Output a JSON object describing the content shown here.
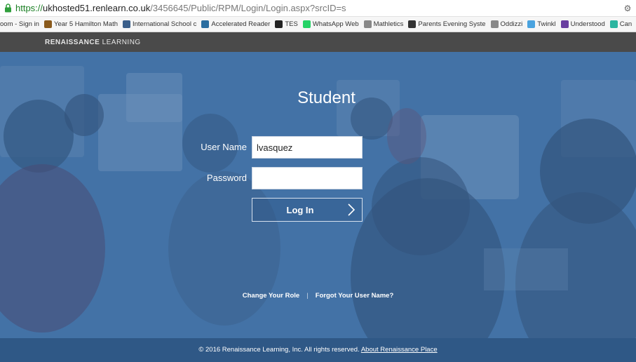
{
  "browser": {
    "url_proto": "https://",
    "url_host": "ukhosted51.renlearn.co.uk",
    "url_path": "/3456645/Public/RPM/Login/Login.aspx?srcID=s",
    "bookmarks": [
      {
        "label": "oom - Sign in",
        "icon": "none",
        "color": "#000000"
      },
      {
        "label": "Year 5 Hamilton Math",
        "icon": "hamilton-icon",
        "color": "#8a5a1c"
      },
      {
        "label": "International School c",
        "icon": "school-icon",
        "color": "#3b5f8a"
      },
      {
        "label": "Accelerated Reader",
        "icon": "rl-icon",
        "color": "#2c6ea0"
      },
      {
        "label": "TES",
        "icon": "tes-icon",
        "color": "#222222"
      },
      {
        "label": "WhatsApp Web",
        "icon": "whatsapp-icon",
        "color": "#25d366"
      },
      {
        "label": "Mathletics",
        "icon": "page-icon",
        "color": "#888888"
      },
      {
        "label": "Parents Evening Syste",
        "icon": "parents-icon",
        "color": "#333333"
      },
      {
        "label": "Oddizzi",
        "icon": "page-icon",
        "color": "#888888"
      },
      {
        "label": "Twinkl",
        "icon": "twinkl-icon",
        "color": "#4aa3df"
      },
      {
        "label": "Understood",
        "icon": "understood-icon",
        "color": "#6a3fa0"
      },
      {
        "label": "Can",
        "icon": "can-icon",
        "color": "#2cb5a0"
      }
    ]
  },
  "brand": {
    "bold": "RENAISSANCE",
    "rest": " LEARNING"
  },
  "login": {
    "title": "Student",
    "username_label": "User Name",
    "username_value": "lvasquez",
    "password_label": "Password",
    "password_value": "",
    "button_label": "Log In"
  },
  "links": {
    "change_role": "Change Your Role",
    "separator": "|",
    "forgot_username": "Forgot Your User Name?"
  },
  "footer": {
    "copyright": "© 2016 Renaissance Learning, Inc. All rights reserved.",
    "about_link": "About Renaissance Place"
  },
  "colors": {
    "hero_blue": "#3f6da0",
    "topbar": "#4a4a4a",
    "footer": "#2f5886"
  }
}
